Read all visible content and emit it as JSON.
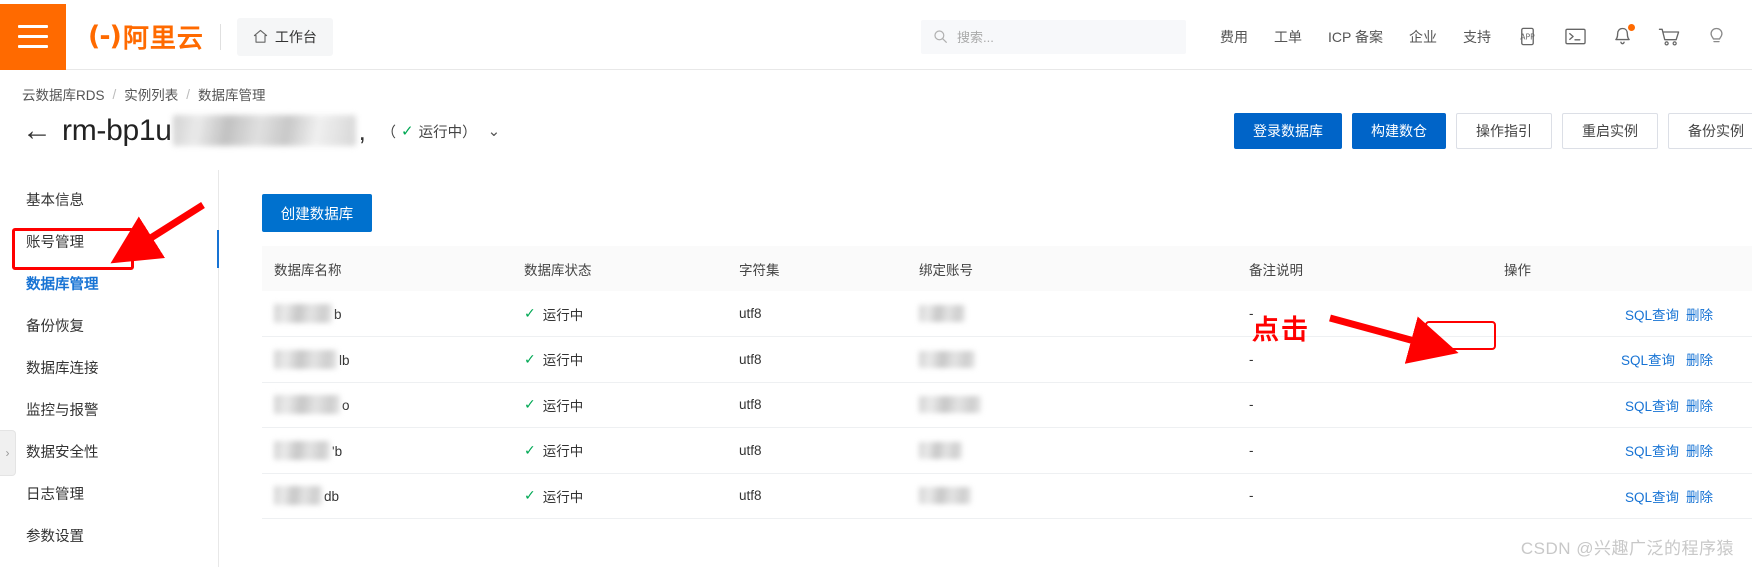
{
  "topnav": {
    "menu_icon": "hamburger-menu-icon",
    "logo_text": "阿里云",
    "workbench_label": "工作台",
    "search_placeholder": "搜索...",
    "search_value": "",
    "links": [
      {
        "label": "费用"
      },
      {
        "label": "工单"
      },
      {
        "label": "ICP 备案"
      },
      {
        "label": "企业"
      },
      {
        "label": "支持"
      }
    ],
    "icons": [
      {
        "name": "app-icon",
        "label": "APP"
      },
      {
        "name": "console-terminal-icon",
        "label": ">_"
      },
      {
        "name": "notification-bell-icon",
        "label": ""
      },
      {
        "name": "shopping-cart-icon",
        "label": ""
      },
      {
        "name": "help-lightbulb-icon",
        "label": ""
      }
    ]
  },
  "breadcrumb": {
    "items": [
      {
        "label": "云数据库RDS"
      },
      {
        "label": "实例列表"
      },
      {
        "label": "数据库管理"
      }
    ],
    "separator": "/"
  },
  "instance": {
    "back_label": "←",
    "name_prefix": "rm-bp1u",
    "name_suffix": ",",
    "status_label": "运行中",
    "status_paren_open": "（",
    "status_paren_close": "）",
    "status_color": "#00a854",
    "dropdown_caret": "⌄"
  },
  "actions": [
    {
      "label": "登录数据库",
      "style": "primary"
    },
    {
      "label": "构建数仓",
      "style": "primary"
    },
    {
      "label": "操作指引",
      "style": "default"
    },
    {
      "label": "重启实例",
      "style": "default"
    },
    {
      "label": "备份实例",
      "style": "default"
    }
  ],
  "sidebar": {
    "items": [
      {
        "label": "基本信息",
        "active": false
      },
      {
        "label": "账号管理",
        "active": false
      },
      {
        "label": "数据库管理",
        "active": true
      },
      {
        "label": "备份恢复",
        "active": false
      },
      {
        "label": "数据库连接",
        "active": false
      },
      {
        "label": "监控与报警",
        "active": false
      },
      {
        "label": "数据安全性",
        "active": false
      },
      {
        "label": "日志管理",
        "active": false
      },
      {
        "label": "参数设置",
        "active": false
      }
    ],
    "collapse_caret": "›"
  },
  "main": {
    "create_button": "创建数据库",
    "columns": [
      "数据库名称",
      "数据库状态",
      "字符集",
      "绑定账号",
      "备注说明",
      "操作"
    ],
    "rows": [
      {
        "name_blur_width": 58,
        "name_suffix": "b",
        "status": "运行中",
        "charset": "utf8",
        "account_blur_width": 46,
        "remark": "-",
        "action_sql": "SQL查询",
        "action_delete": "删除",
        "highlight": false
      },
      {
        "name_blur_width": 63,
        "name_suffix": "lb",
        "status": "运行中",
        "charset": "utf8",
        "account_blur_width": 56,
        "remark": "-",
        "action_sql": "SQL查询",
        "action_delete": "删除",
        "highlight": true
      },
      {
        "name_blur_width": 66,
        "name_suffix": "o",
        "status": "运行中",
        "charset": "utf8",
        "account_blur_width": 62,
        "remark": "-",
        "action_sql": "SQL查询",
        "action_delete": "删除",
        "highlight": false
      },
      {
        "name_blur_width": 56,
        "name_suffix": "'b",
        "status": "运行中",
        "charset": "utf8",
        "account_blur_width": 43,
        "remark": "-",
        "action_sql": "SQL查询",
        "action_delete": "删除",
        "highlight": false
      },
      {
        "name_blur_width": 48,
        "name_suffix": "db",
        "status": "运行中",
        "charset": "utf8",
        "account_blur_width": 52,
        "remark": "-",
        "action_sql": "SQL查询",
        "action_delete": "删除",
        "highlight": false
      }
    ],
    "status_check": "✓"
  },
  "annotations": {
    "click_label": "点击",
    "annotation_color": "#ff0000"
  },
  "watermark": "CSDN @兴趣广泛的程序猿"
}
